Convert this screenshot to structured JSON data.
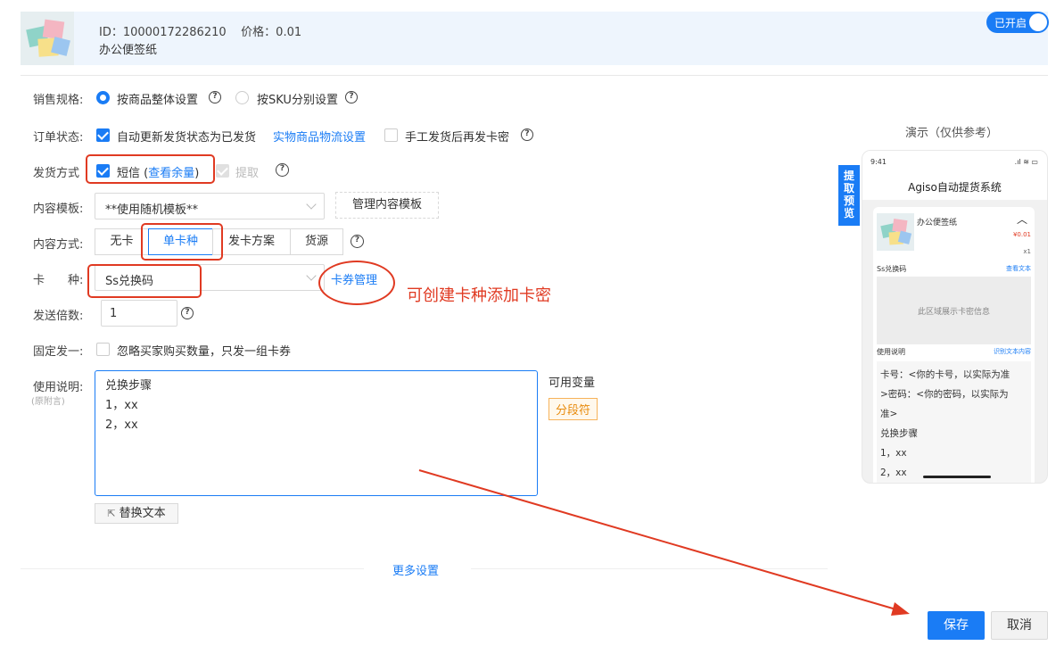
{
  "product": {
    "id_label": "ID：10000172286210",
    "price_label": "价格：0.01",
    "name": "办公便签纸",
    "toggle_label": "已开启"
  },
  "form": {
    "spec": {
      "label": "销售规格:",
      "opt1": "按商品整体设置",
      "opt2": "按SKU分别设置"
    },
    "order_status": {
      "label": "订单状态:",
      "opt1": "自动更新发货状态为已发货",
      "link": "实物商品物流设置",
      "opt2": "手工发货后再发卡密"
    },
    "ship_method": {
      "label": "发货方式",
      "sms": "短信",
      "sms_link_open": "(",
      "sms_link": "查看余量",
      "sms_link_close": ")",
      "extract": "提取"
    },
    "template": {
      "label": "内容模板:",
      "value": "**使用随机模板**",
      "manage_button": "管理内容模板"
    },
    "content_mode": {
      "label": "内容方式:",
      "options": [
        "无卡",
        "单卡种",
        "发卡方案",
        "货源"
      ]
    },
    "card_type": {
      "label": "卡　　种:",
      "value": "Ss兑换码",
      "manage_link": "卡券管理"
    },
    "send_multiplier": {
      "label": "发送倍数:",
      "value": "1"
    },
    "fixed_one": {
      "label": "固定发一:",
      "text": "忽略买家购买数量，只发一组卡券"
    },
    "usage": {
      "label": "使用说明:",
      "sublabel": "(原附言)",
      "value": "兑换步骤\n1，xx\n2，xx",
      "vars_label": "可用变量",
      "var_tag": "分段符",
      "replace_button": "替换文本"
    },
    "more_settings": "更多设置"
  },
  "annotation": {
    "text": "可创建卡种添加卡密"
  },
  "preview": {
    "header": "演示（仅供参考）",
    "tab_label": [
      "提",
      "取",
      "预",
      "览"
    ],
    "time": "9:41",
    "app_title": "Agiso自动提货系统",
    "product_name": "办公便签纸",
    "price": "¥0.01",
    "qty": "x1",
    "card_name": "Ss兑换码",
    "view_text": "查看文本",
    "card_area_text": "此区域展示卡密信息",
    "usage_title": "使用说明",
    "usage_link": "识别文本内容",
    "usage_lines": [
      "卡号：<你的卡号，以实际为准",
      ">密码：<你的密码，以实际为",
      "准>",
      "兑换步骤",
      "1，xx",
      "2，xx"
    ]
  },
  "actions": {
    "save": "保存",
    "cancel": "取消"
  },
  "colors": {
    "accent": "#1a7cf5",
    "annotation": "#e03a22",
    "tag_orange": "#e88b0e"
  }
}
